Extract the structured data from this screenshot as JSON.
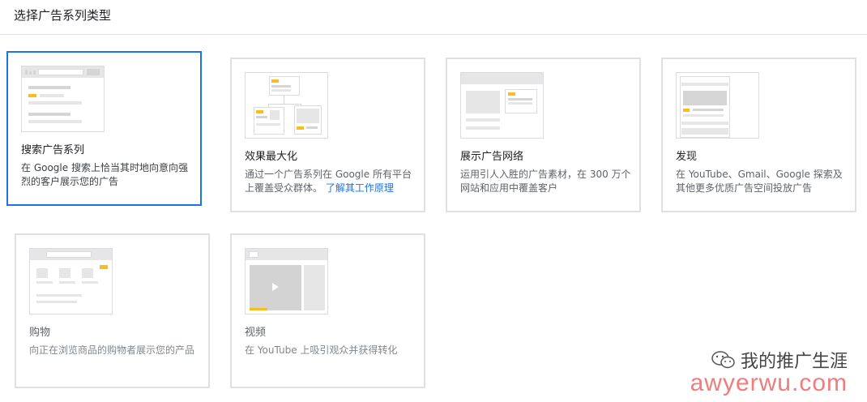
{
  "header": {
    "title": "选择广告系列类型"
  },
  "cards": [
    {
      "title": "搜索广告系列",
      "desc": "在 Google 搜索上恰当其时地向意向强烈的客户展示您的广告",
      "icon": "search-ads-illustration"
    },
    {
      "title": "效果最大化",
      "desc": "通过一个广告系列在 Google 所有平台上覆盖受众群体。",
      "link": "了解其工作原理",
      "icon": "performance-max-illustration"
    },
    {
      "title": "展示广告网络",
      "desc": "运用引人入胜的广告素材，在 300 万个网站和应用中覆盖客户",
      "icon": "display-ads-illustration"
    },
    {
      "title": "发现",
      "desc": "在 YouTube、Gmail、Google 探索及其他更多优质广告空间投放广告",
      "icon": "discovery-illustration"
    },
    {
      "title": "购物",
      "desc": "向正在浏览商品的购物者展示您的产品",
      "icon": "shopping-illustration"
    },
    {
      "title": "视频",
      "desc": "在 YouTube 上吸引观众并获得转化",
      "icon": "video-illustration"
    }
  ],
  "watermark": {
    "line1": "我的推广生涯",
    "line2": "awyerwu.com"
  },
  "colors": {
    "accent": "#1a73e8",
    "yellow": "#f8bd1f",
    "border": "#e0e0e0"
  }
}
